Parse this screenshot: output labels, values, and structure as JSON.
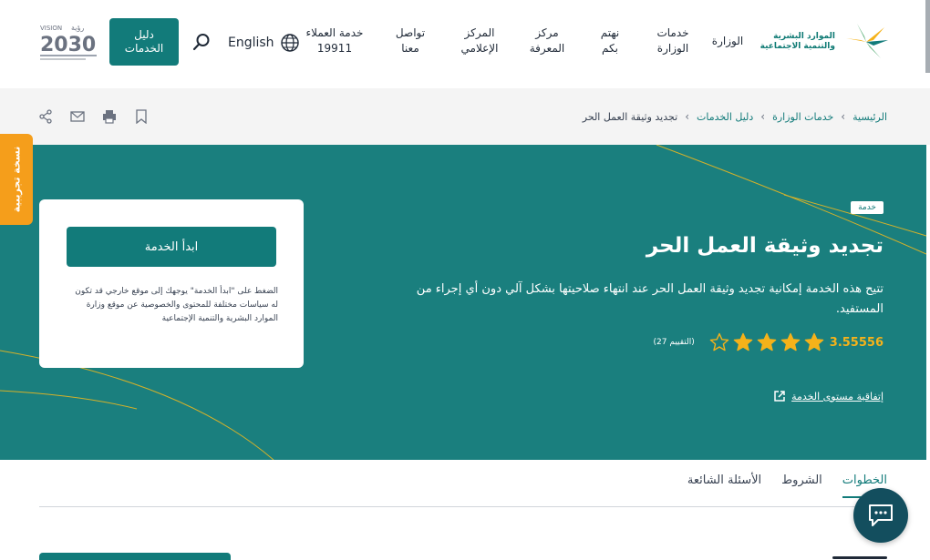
{
  "header": {
    "logo_line1": "الموارد البشرية",
    "logo_line2": "والتنمية الاجتماعية",
    "nav": [
      {
        "label": "الوزارة"
      },
      {
        "label": "خدمات\nالوزارة"
      },
      {
        "label": "نهتم\nبكم"
      },
      {
        "label": "مركز\nالمعرفة"
      },
      {
        "label": "المركز\nالإعلامي"
      },
      {
        "label": "تواصل\nمعنا"
      },
      {
        "label": "خدمة العملاء\n19911"
      }
    ],
    "language_label": "English",
    "services_guide_label": "دليل\nالخدمات",
    "vision_text": "VISION رؤية 2030",
    "vision_year": "2030"
  },
  "breadcrumb": [
    {
      "label": "الرئيسية"
    },
    {
      "label": "خدمات الوزارة"
    },
    {
      "label": "دليل الخدمات"
    },
    {
      "label": "تجديد وثيقة العمل الحر"
    }
  ],
  "service": {
    "tag": "خدمة",
    "title": "تجديد وثيقة العمل الحر",
    "description": "تتيح هذه الخدمة إمكانية تجديد وثيقة العمل الحر عند انتهاء صلاحيتها بشكل آلي دون أي إجراء من المستفيد.",
    "rating_value": "3.55556",
    "rating_fraction": 0.7111,
    "rating_count": "(التقييم 27)",
    "sla_link": "إتفاقية مستوى الخدمة"
  },
  "card": {
    "start_button": "ابدأ الخدمة",
    "note": "الضغط على \"ابدأ الخدمة\" يوجهك إلى موقع خارجي قد تكون له سياسات مختلفة للمحتوى والخصوصية عن موقع وزارة الموارد البشرية والتنمية الإجتماعية"
  },
  "trial_badge": "نسخة تجريبية",
  "tabs": [
    {
      "label": "الخطوات",
      "active": true
    },
    {
      "label": "الشروط",
      "active": false
    },
    {
      "label": "الأسئلة الشائعة",
      "active": false
    }
  ],
  "colors": {
    "brand": "#127b7a",
    "hero": "#1a7f7e",
    "star": "#f5b21a",
    "trial": "#f59e1b"
  },
  "icons": {
    "tools": [
      "bookmark-icon",
      "print-icon",
      "mail-icon",
      "share-icon"
    ],
    "language": "globe-icon",
    "search": "search-icon",
    "chat": "chat-icon",
    "external": "external-link-icon"
  }
}
